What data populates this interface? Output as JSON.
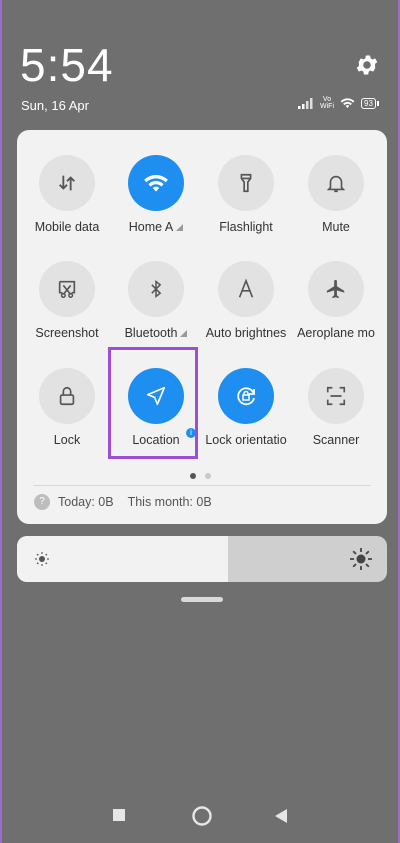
{
  "status_bar": {
    "time": "5:54",
    "date": "Sun, 16 Apr",
    "volte_label_top": "Vo",
    "volte_label_bottom": "WiFi",
    "battery": "93"
  },
  "tiles": [
    {
      "label": "Mobile data",
      "icon": "mobile-data-icon",
      "active": false
    },
    {
      "label": "Home A",
      "icon": "wifi-icon",
      "active": true,
      "has_arrow": true
    },
    {
      "label": "Flashlight",
      "icon": "flashlight-icon",
      "active": false
    },
    {
      "label": "Mute",
      "icon": "bell-icon",
      "active": false
    },
    {
      "label": "Screenshot",
      "icon": "screenshot-icon",
      "active": false
    },
    {
      "label": "Bluetooth",
      "icon": "bluetooth-icon",
      "active": false,
      "has_arrow": true
    },
    {
      "label": "Auto brightnes",
      "icon": "auto-brightness-icon",
      "active": false
    },
    {
      "label": "Aeroplane mo",
      "icon": "airplane-icon",
      "active": false
    },
    {
      "label": "Lock",
      "icon": "lock-icon",
      "active": false
    },
    {
      "label": "Location",
      "icon": "location-icon",
      "active": true
    },
    {
      "label": "Lock orientatio",
      "icon": "lock-rotation-icon",
      "active": true
    },
    {
      "label": "Scanner",
      "icon": "scanner-icon",
      "active": false
    }
  ],
  "info_dot": "i",
  "data_usage": {
    "today": "Today: 0B",
    "month": "This month: 0B",
    "gb_icon_text": "?"
  },
  "brightness": {
    "level_percent": 57
  },
  "colors": {
    "accent": "#1f8ef1",
    "highlight": "#9b4fd6"
  }
}
